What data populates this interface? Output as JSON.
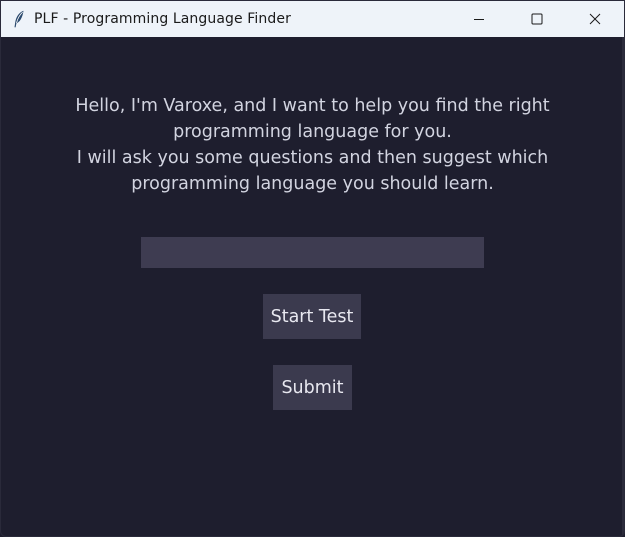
{
  "window": {
    "title": "PLF - Programming Language Finder",
    "app_icon": "feather-icon",
    "controls": [
      "minimize-icon",
      "maximize-icon",
      "close-icon"
    ]
  },
  "main": {
    "intro_lines": [
      "Hello, I'm Varoxe, and I want to help you find the right",
      "programming language for you.",
      "I will ask you some questions and then suggest which",
      "programming language you should learn."
    ],
    "answer_input": {
      "value": "",
      "placeholder": ""
    },
    "start_button_label": "Start Test",
    "submit_button_label": "Submit"
  },
  "colors": {
    "background": "#1e1e2e",
    "titlebar": "#eef3f9",
    "input_bg": "#3e3c51",
    "button_bg": "#3b3a4e",
    "text": "#d2d4e0"
  }
}
